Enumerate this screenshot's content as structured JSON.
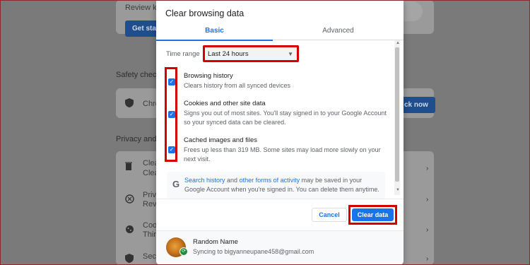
{
  "background": {
    "review_key_text": "Review key",
    "get_started_label": "Get sta",
    "safety_check_heading": "Safety check",
    "safety_row_text": "Chro",
    "check_now_label": "ck now",
    "privacy_heading": "Privacy and s",
    "rows": [
      {
        "title": "Clea",
        "sub": "Clea"
      },
      {
        "title": "Priva",
        "sub": "Revie"
      },
      {
        "title": "Cook",
        "sub": "Third"
      },
      {
        "title": "Secu",
        "sub": ""
      }
    ]
  },
  "dialog": {
    "title": "Clear browsing data",
    "tabs": [
      {
        "label": "Basic",
        "active": true
      },
      {
        "label": "Advanced",
        "active": false
      }
    ],
    "time_range": {
      "label": "Time range",
      "selected": "Last 24 hours"
    },
    "items": [
      {
        "title": "Browsing history",
        "description": "Clears history from all synced devices",
        "checked": true
      },
      {
        "title": "Cookies and other site data",
        "description": "Signs you out of most sites. You'll stay signed in to your Google Account so your synced data can be cleared.",
        "checked": true
      },
      {
        "title": "Cached images and files",
        "description": "Frees up less than 319 MB. Some sites may load more slowly on your next visit.",
        "checked": true
      }
    ],
    "info": {
      "link1": "Search history",
      "and": " and ",
      "link2": "other forms of activity",
      "rest": " may be saved in your Google Account when you're signed in. You can delete them anytime."
    },
    "buttons": {
      "cancel": "Cancel",
      "clear": "Clear data"
    },
    "account": {
      "name": "Random Name",
      "sync_text": "Syncing to bigyanneupane458@gmail.com"
    }
  },
  "colors": {
    "accent": "#1a73e8",
    "highlight": "#d40000",
    "overlay": "#7a7a7a"
  },
  "icons": [
    "check-icon",
    "dropdown-arrow-icon",
    "google-icon",
    "sync-icon",
    "shield-icon",
    "trash-icon",
    "globe-icon",
    "cookie-icon",
    "lock-icon",
    "chevron-right-icon"
  ]
}
